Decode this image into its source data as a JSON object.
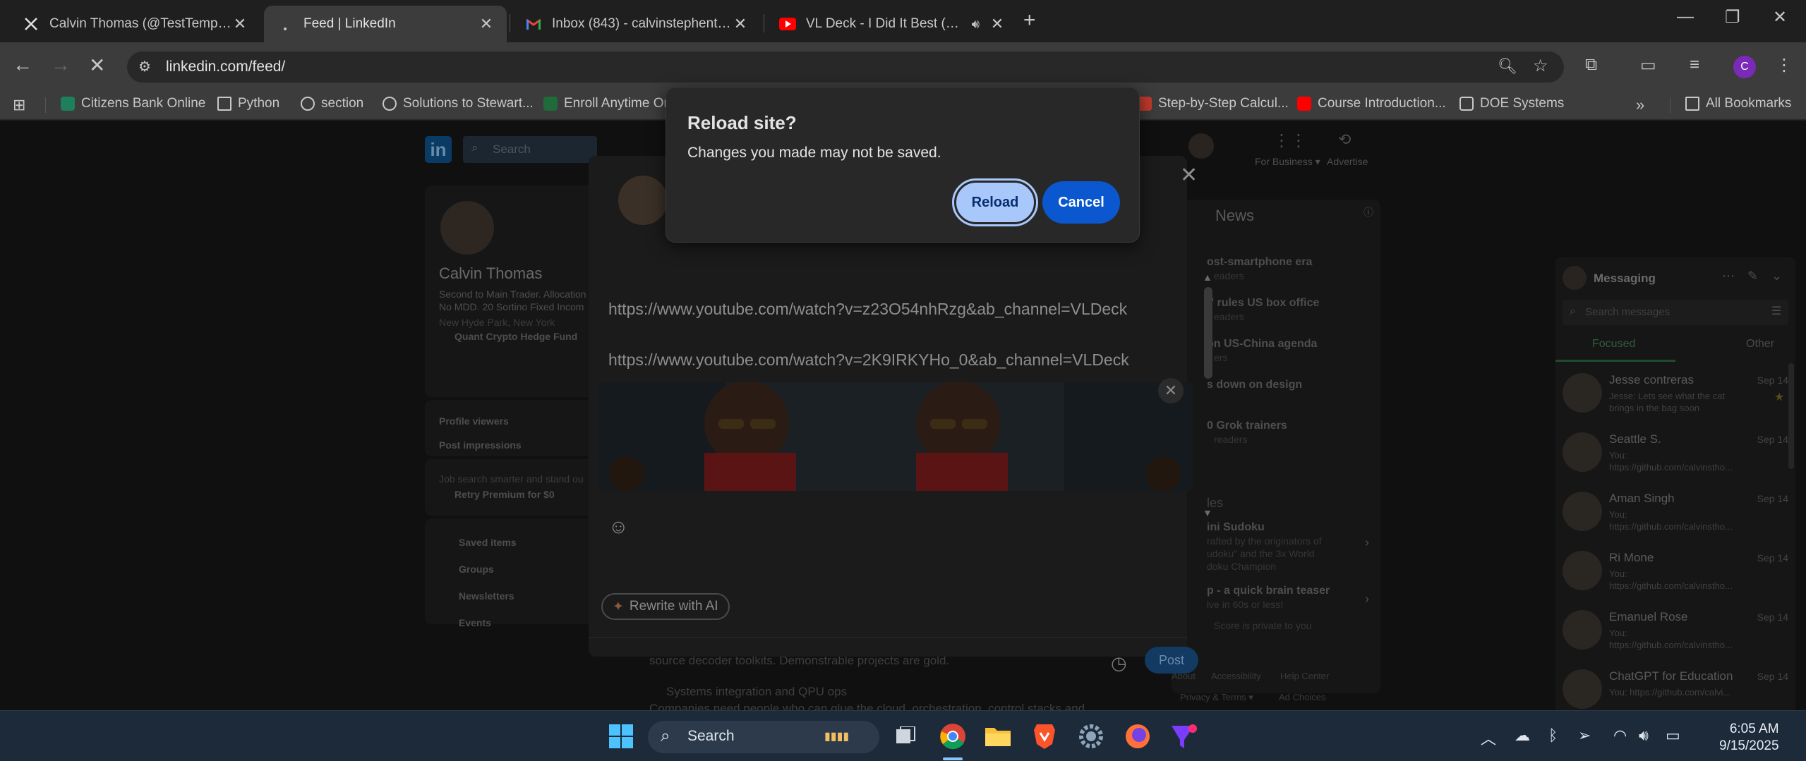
{
  "browser": {
    "tabs": [
      {
        "title": "Calvin Thomas (@TestTempAI) /",
        "favicon": "x-logo-icon",
        "active": false
      },
      {
        "title": "Feed | LinkedIn",
        "favicon": "loading-icon",
        "active": true
      },
      {
        "title": "Inbox (843) - calvinstephenthom",
        "favicon": "gmail-icon",
        "active": false
      },
      {
        "title": "VL Deck - I Did It Best (Sho",
        "favicon": "youtube-icon",
        "active": false
      }
    ],
    "new_tab": "+",
    "url": "linkedin.com/feed/",
    "profile_initial": "C",
    "bookmarks": [
      {
        "label": "Citizens Bank Online"
      },
      {
        "label": "Python"
      },
      {
        "label": "section"
      },
      {
        "label": "Solutions to Stewart..."
      },
      {
        "label": "Enroll Anytime Or"
      },
      {
        "label": "Step-by-Step Calcul..."
      },
      {
        "label": "Course Introduction..."
      },
      {
        "label": "DOE Systems"
      }
    ],
    "all_bookmarks": "All Bookmarks",
    "colors": {
      "accent": "#a8c7fa",
      "cancel": "#0b57d0",
      "tab_active": "#3c3c3c"
    }
  },
  "dialog": {
    "title": "Reload site?",
    "message": "Changes you made may not be saved.",
    "reload_label": "Reload",
    "cancel_label": "Cancel"
  },
  "linkedin": {
    "search_placeholder": "Search",
    "for_business": "For Business ▾",
    "advertise": "Advertise",
    "profile": {
      "name": "Calvin Thomas",
      "headline_1": "Second to Main Trader. Allocation",
      "headline_2": "No MDD. 20 Sortino Fixed Incom",
      "location": "New Hyde Park, New York",
      "company": "Quant Crypto Hedge Fund"
    },
    "stats": {
      "viewers": "Profile viewers",
      "impressions": "Post impressions"
    },
    "premium": {
      "line": "Job search smarter and stand ou",
      "cta": "Retry Premium for $0"
    },
    "side_links": [
      "Saved items",
      "Groups",
      "Newsletters",
      "Events"
    ],
    "composer": {
      "link_1": "https://www.youtube.com/watch?v=z23O54nhRzg&ab_channel=VLDeck",
      "link_2": "https://www.youtube.com/watch?v=2K9IRKYHo_0&ab_channel=VLDeck",
      "rewrite_label": "Rewrite with AI",
      "post_label": "Post"
    },
    "feed_text": {
      "line_1": "source decoder toolkits. Demonstrable projects are gold.",
      "line_2": "Systems integration and QPU ops",
      "line_3": "Companies need people who can glue the cloud, orchestration, control stacks and"
    },
    "news": {
      "header": "News",
      "items": [
        {
          "title": "ost-smartphone era",
          "sub": "eaders"
        },
        {
          "title": "r' rules US box office",
          "sub": "eaders"
        },
        {
          "title": "on US-China agenda",
          "sub": "ers"
        },
        {
          "title": "s down on design",
          "sub": ""
        },
        {
          "title": "0 Grok trainers",
          "sub": "readers"
        }
      ],
      "games_header": "les",
      "games": [
        {
          "title": "ini Sudoku",
          "sub_1": "rafted by the originators of",
          "sub_2": "udoku\" and the 3x World",
          "sub_3": "doku Champion"
        },
        {
          "title": "p - a quick brain teaser",
          "sub_1": "lve in 60s or less!",
          "sub_2": "Score is private to you"
        }
      ]
    },
    "footer": [
      "About",
      "Accessibility",
      "Help Center",
      "Privacy & Terms ▾",
      "Ad Choices"
    ],
    "messaging": {
      "header": "Messaging",
      "search_placeholder": "Search messages",
      "tab_focused": "Focused",
      "tab_other": "Other",
      "conversations": [
        {
          "name": "Jesse contreras",
          "date": "Sep 14",
          "snippet": "Jesse: Lets see what the cat brings in the bag soon"
        },
        {
          "name": "Seattle S.",
          "date": "Sep 14",
          "snippet": "You: https://github.com/calvinstho..."
        },
        {
          "name": "Aman Singh",
          "date": "Sep 14",
          "snippet": "You: https://github.com/calvinstho..."
        },
        {
          "name": "Ri Mone",
          "date": "Sep 14",
          "snippet": "You: https://github.com/calvinstho..."
        },
        {
          "name": "Emanuel Rose",
          "date": "Sep 14",
          "snippet": "You: https://github.com/calvinstho..."
        },
        {
          "name": "ChatGPT for Education",
          "date": "Sep 14",
          "snippet": "You: https://github.com/calvi..."
        }
      ]
    }
  },
  "taskbar": {
    "search_label": "Search",
    "time": "6:05 AM",
    "date": "9/15/2025"
  }
}
